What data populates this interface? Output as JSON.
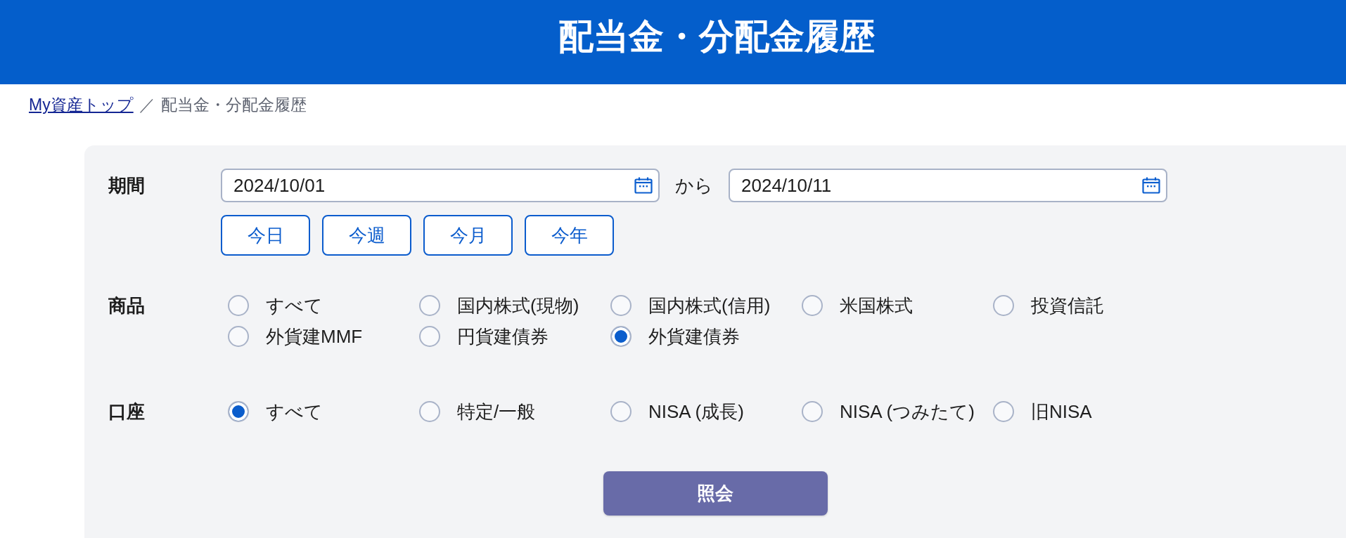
{
  "header": {
    "title": "配当金・分配金履歴"
  },
  "breadcrumb": {
    "separator": "／",
    "items": [
      {
        "label": "My資産トップ",
        "kind": "link"
      },
      {
        "label": "配当金・分配金履歴",
        "kind": "current"
      }
    ]
  },
  "form": {
    "period": {
      "label": "期間",
      "from": {
        "value": "2024/10/01"
      },
      "connector": "から",
      "to": {
        "value": "2024/10/11"
      },
      "presets": [
        "今日",
        "今週",
        "今月",
        "今年"
      ]
    },
    "product": {
      "label": "商品",
      "options": [
        {
          "label": "すべて",
          "selected": false
        },
        {
          "label": "国内株式(現物)",
          "selected": false
        },
        {
          "label": "国内株式(信用)",
          "selected": false
        },
        {
          "label": "米国株式",
          "selected": false
        },
        {
          "label": "投資信託",
          "selected": false
        },
        {
          "label": "外貨建MMF",
          "selected": false
        },
        {
          "label": "円貨建債券",
          "selected": false
        },
        {
          "label": "外貨建債券",
          "selected": true
        }
      ]
    },
    "account": {
      "label": "口座",
      "options": [
        {
          "label": "すべて",
          "selected": true
        },
        {
          "label": "特定/一般",
          "selected": false
        },
        {
          "label": "NISA (成長)",
          "selected": false
        },
        {
          "label": "NISA (つみたて)",
          "selected": false
        },
        {
          "label": "旧NISA",
          "selected": false
        }
      ]
    },
    "submit": {
      "label": "照会"
    }
  }
}
